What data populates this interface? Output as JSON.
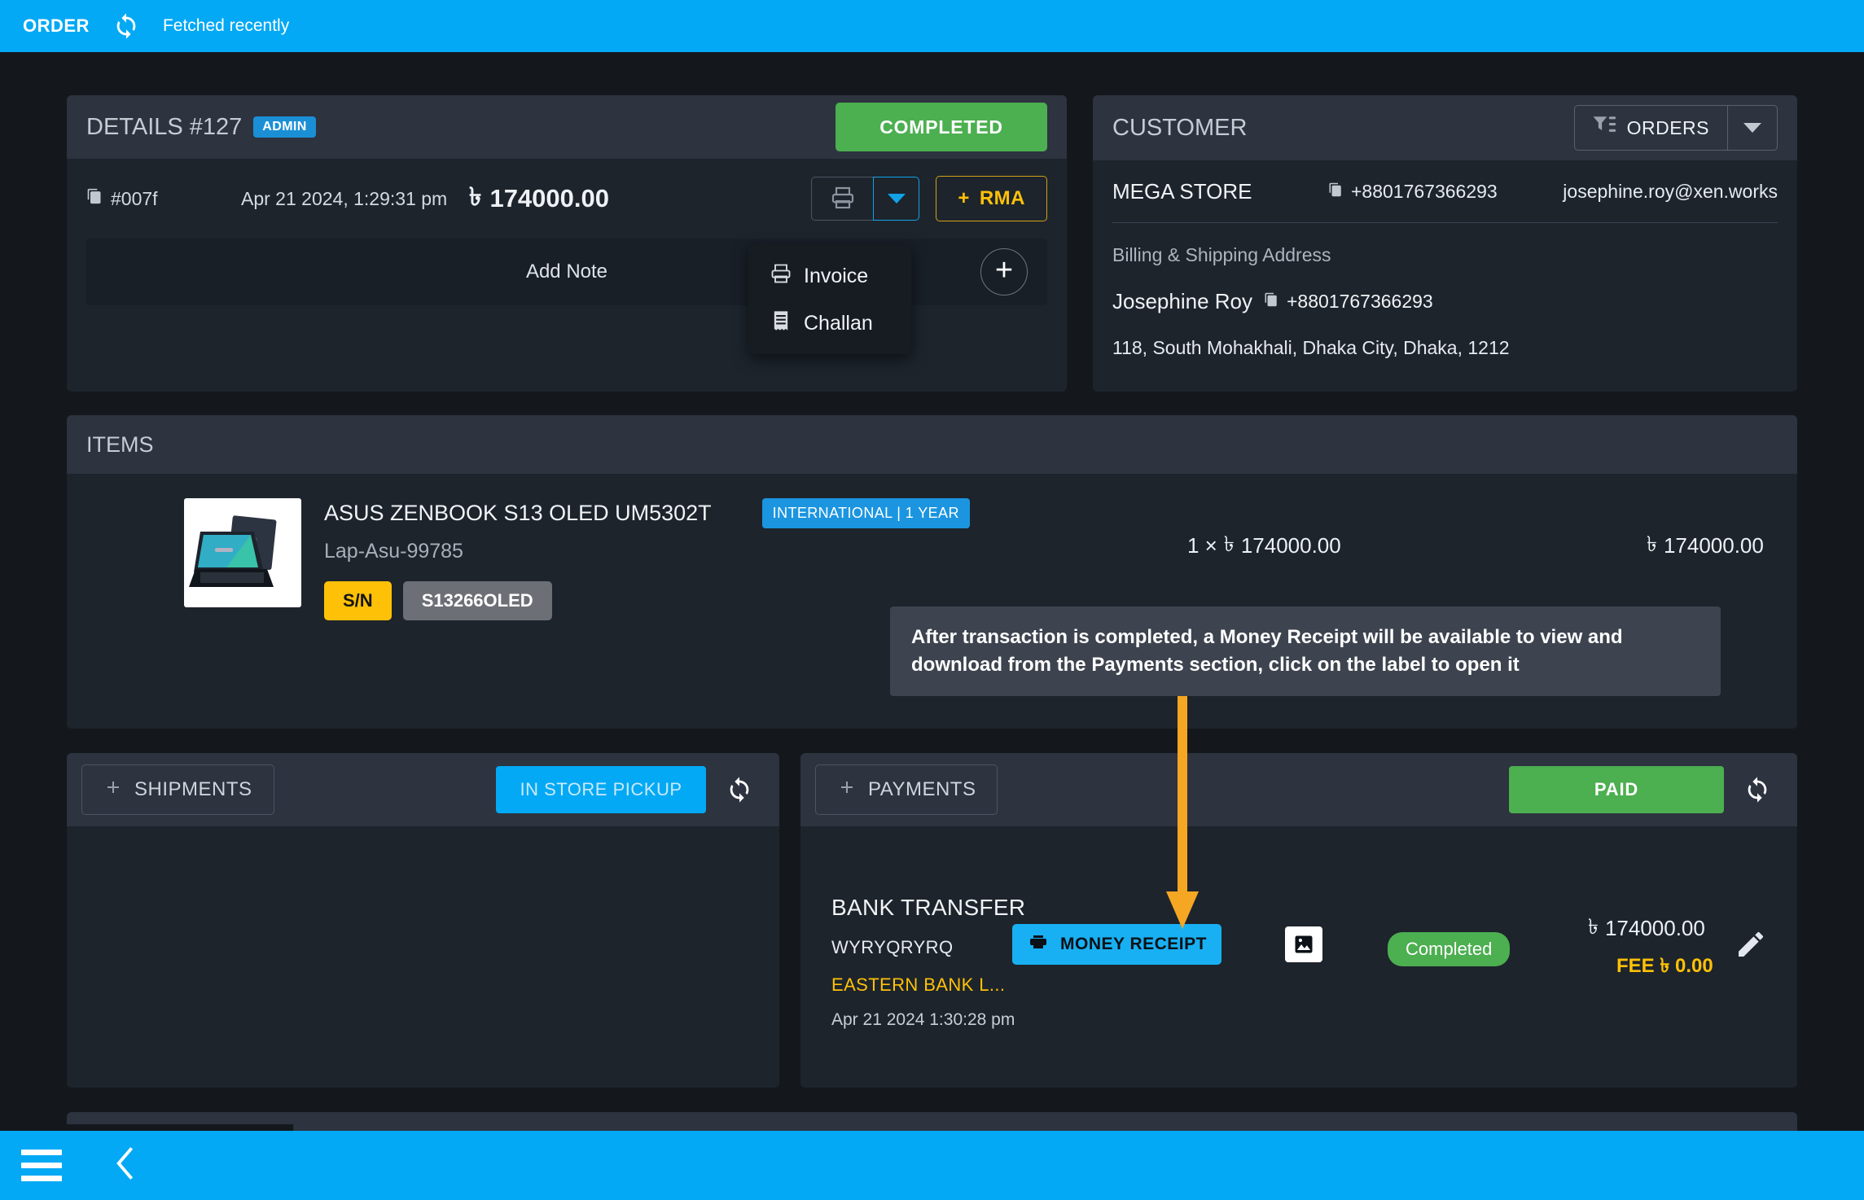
{
  "topbar": {
    "title": "ORDER",
    "sync_icon": "sync-icon",
    "status": "Fetched recently"
  },
  "details": {
    "heading": "DETAILS #127",
    "admin_badge": "ADMIN",
    "status_button": "COMPLETED",
    "order_ref": "#007f",
    "order_date": "Apr 21 2024, 1:29:31 pm",
    "currency": "৳",
    "amount": "174000.00",
    "print_icon": "printer-icon",
    "rma_button": "RMA",
    "add_note": "Add Note",
    "add_note_plus": "+",
    "print_menu": [
      {
        "label": "Invoice",
        "icon": "printer-icon"
      },
      {
        "label": "Challan",
        "icon": "receipt-icon"
      }
    ]
  },
  "customer": {
    "heading": "CUSTOMER",
    "orders_button": "ORDERS",
    "filter_icon": "filter-list-icon",
    "store_name": "MEGA STORE",
    "phone": "+8801767366293",
    "email": "josephine.roy@xen.works",
    "address_label": "Billing & Shipping Address",
    "person_name": "Josephine Roy",
    "person_phone": "+8801767366293",
    "address": "118, South Mohakhali, Dhaka City, Dhaka, 1212"
  },
  "items": {
    "heading": "ITEMS",
    "rows": [
      {
        "name": "ASUS ZENBOOK S13 OLED UM5302T",
        "warranty_badge": "INTERNATIONAL | 1 YEAR",
        "sku": "Lap-Asu-99785",
        "sn_label": "S/N",
        "serial": "S13266OLED",
        "qty_line": "1 ×",
        "unit_currency": "৳",
        "unit_price": "174000.00",
        "total_currency": "৳",
        "total_price": "174000.00"
      }
    ]
  },
  "callout": {
    "text": "After transaction is completed, a Money Receipt will be available to view and download from the Payments section, click on the label to open it",
    "arrow_color": "#F5A623"
  },
  "shipments": {
    "heading": "SHIPMENTS",
    "add_icon": "plus-icon",
    "pickup_button": "IN STORE PICKUP",
    "refresh_icon": "refresh-icon"
  },
  "payments": {
    "heading": "PAYMENTS",
    "add_icon": "plus-icon",
    "paid_button": "PAID",
    "refresh_icon": "refresh-icon",
    "row": {
      "card_icon": "card-chip-icon",
      "method": "BANK TRANSFER",
      "reference": "WYRYQRYRQ",
      "bank": "EASTERN BANK L...",
      "date": "Apr 21 2024 1:30:28 pm",
      "receipt_button": "MONEY RECEIPT",
      "receipt_icon": "printer-icon",
      "image_icon": "image-icon",
      "status_pill": "Completed",
      "amount_currency": "৳",
      "amount": "174000.00",
      "fee": "FEE ৳ 0.00",
      "edit_icon": "pencil-icon"
    }
  },
  "bottombar": {
    "menu_icon": "hamburger-icon",
    "back_icon": "chevron-left-icon"
  },
  "colors": {
    "accent": "#03A9F4",
    "success": "#4CAF50",
    "warning": "#FFC107",
    "page_bg": "#14181d",
    "card_bg": "#1d242c",
    "card_head_bg": "#2d333f"
  }
}
